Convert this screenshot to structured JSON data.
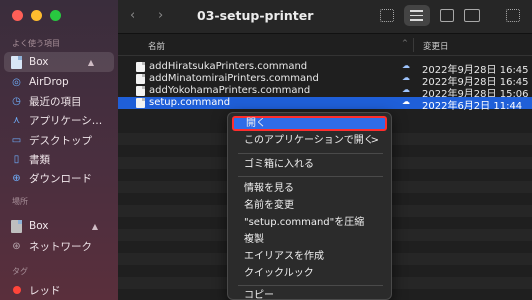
{
  "sidebar": {
    "section_favorites": "よく使う項目",
    "section_locations": "場所",
    "section_tags": "タグ",
    "items": [
      {
        "label": "Box",
        "icon": "box-folder-icon"
      },
      {
        "label": "AirDrop",
        "icon": "airdrop-icon"
      },
      {
        "label": "最近の項目",
        "icon": "clock-icon"
      },
      {
        "label": "アプリケーシ…",
        "icon": "applications-icon"
      },
      {
        "label": "デスクトップ",
        "icon": "desktop-icon"
      },
      {
        "label": "書類",
        "icon": "document-icon"
      },
      {
        "label": "ダウンロード",
        "icon": "download-icon"
      }
    ],
    "locations": [
      {
        "label": "Box",
        "icon": "box-folder-icon"
      },
      {
        "label": "ネットワーク",
        "icon": "network-icon"
      }
    ],
    "tags": [
      {
        "label": "レッド",
        "color": "#ff453a"
      }
    ]
  },
  "toolbar": {
    "back": "‹",
    "forward": "›",
    "title": "03-setup-printer"
  },
  "list": {
    "col_name": "名前",
    "col_modified": "変更日",
    "rows": [
      {
        "name": "addHiratsukaPrinters.command",
        "date": "2022年9月28日 16:45"
      },
      {
        "name": "addMinatomiraiPrinters.command",
        "date": "2022年9月28日 16:45"
      },
      {
        "name": "addYokohamaPrinters.command",
        "date": "2022年9月28日 15:06"
      },
      {
        "name": "setup.command",
        "date": "2022年6月2日 11:44"
      }
    ]
  },
  "context_menu": {
    "items": [
      "開く",
      "このアプリケーションで開く",
      "ゴミ箱に入れる",
      "情報を見る",
      "名前を変更",
      "\"setup.command\"を圧縮",
      "複製",
      "エイリアスを作成",
      "クイックルック",
      "コピー"
    ],
    "submenu_arrow": ">"
  },
  "colors": {
    "selection": "#1f5fd8",
    "menu_highlight": "#2f6ce8",
    "annotation_border": "#ff2d2d"
  }
}
